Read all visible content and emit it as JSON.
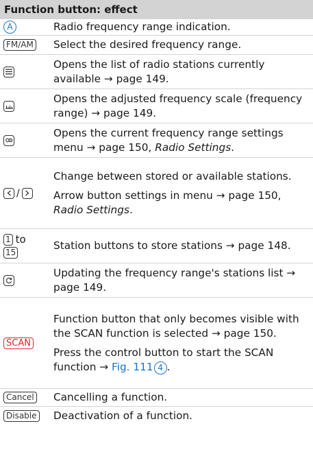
{
  "table": {
    "header": "Function button: effect",
    "rows": [
      {
        "button": "A",
        "text": "Radio frequency range indication."
      },
      {
        "button": "FM/AM",
        "text": "Select the desired frequency range."
      },
      {
        "button_icon": "station-list-icon",
        "text": "Opens the list of radio stations currently available → page 149."
      },
      {
        "button_icon": "frequency-scale-icon",
        "text": "Opens the adjusted frequency scale (frequency range) → page 149."
      },
      {
        "button_icon": "settings-icon",
        "text_a": "Opens the current frequency range set­tings menu → page 150, ",
        "text_b": "Radio Settings",
        "text_c": "."
      },
      {
        "button_left_icon": "arrow-left-icon",
        "separator": "/",
        "button_right_icon": "arrow-right-icon",
        "text1": "Change between stored or available stations.",
        "text2_a": "Arrow button settings in menu → page 150, ",
        "text2_b": "Radio Settings",
        "text2_c": "."
      },
      {
        "button_from": "1",
        "to_word": "to",
        "button_to": "15",
        "text": "Station buttons to store stations → page 148."
      },
      {
        "button_icon": "refresh-icon",
        "text": "Updating the frequency range's stations list → page 149."
      },
      {
        "button": "SCAN",
        "text1": "Function button that only becomes visi­ble with the SCAN function is selected → page 150.",
        "text2_a": "Press the control button to start the SCAN function → ",
        "text2_link": "Fig. 111",
        "text2_num": "4",
        "text2_end": "."
      },
      {
        "button": "Cancel",
        "text": "Cancelling a function."
      },
      {
        "button": "Disable",
        "text": "Deactivation of a function."
      }
    ]
  },
  "colors": {
    "header_bg": "#d3d3d3",
    "accent_blue": "#1a73c8",
    "accent_red": "#e3252b"
  }
}
